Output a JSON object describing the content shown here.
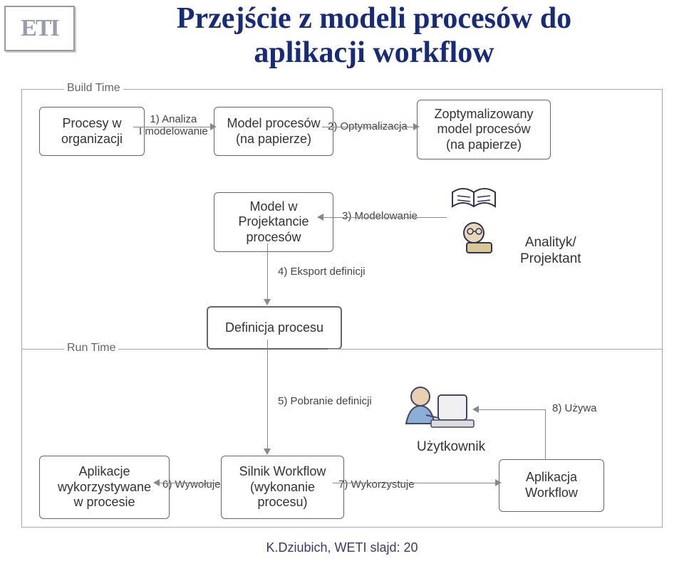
{
  "logo": "ETI",
  "title_line1": "Przejście z modeli procesów do",
  "title_line2": "aplikacji workflow",
  "sections": {
    "build": "Build Time",
    "run": "Run Time"
  },
  "boxes": {
    "b1": "Procesy w\norganizacji",
    "b2": "Model procesów\n(na papierze)",
    "b3": "Zoptymalizowany\nmodel procesów\n(na papierze)",
    "b4": "Model w\nProjektancie\nprocesów",
    "b5": "Definicja procesu",
    "b6": "Aplikacje\nwykorzystywane\nw procesie",
    "b7": "Silnik Workflow\n(wykonanie\nprocesu)",
    "b8": "Aplikacja\nWorkflow"
  },
  "labels": {
    "l1": "1) Analiza\nI modelowanie",
    "l2": "2) Optymalizacja",
    "l3": "3) Modelowanie",
    "l4": "4) Eksport definicji",
    "l5": "5) Pobranie definicji",
    "l6": "6) Wywołuje",
    "l7": "7) Wykorzystuje",
    "l8": "8) Używa",
    "analyst": "Analityk/\nProjektant",
    "user": "Użytkownik"
  },
  "footer": "K.Dziubich, WETI slajd: 20"
}
